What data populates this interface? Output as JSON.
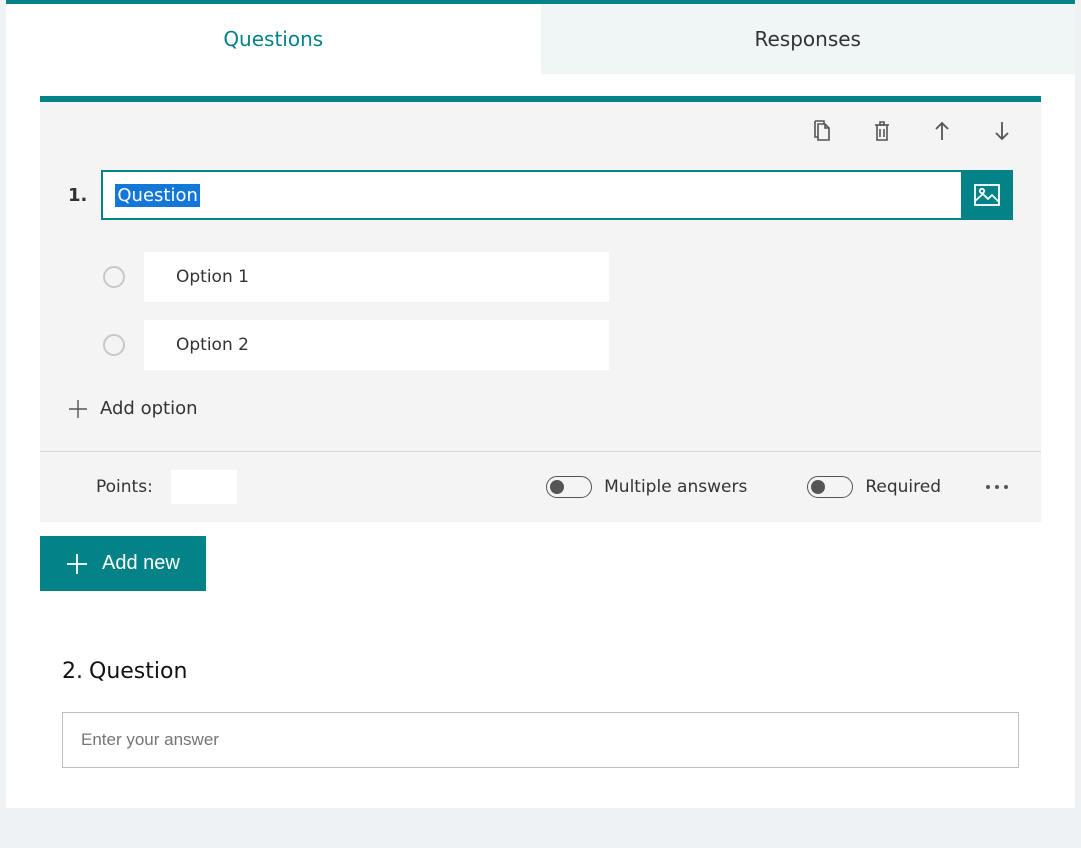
{
  "tabs": {
    "questions": "Questions",
    "responses": "Responses"
  },
  "q1": {
    "number": "1.",
    "title": "Question",
    "options": [
      "Option 1",
      "Option 2"
    ],
    "add_option": "Add option",
    "footer": {
      "points_label": "Points:",
      "multiple": "Multiple answers",
      "required": "Required"
    }
  },
  "add_new": "Add new",
  "q2": {
    "number": "2.",
    "title": "Question",
    "placeholder": "Enter your answer"
  }
}
